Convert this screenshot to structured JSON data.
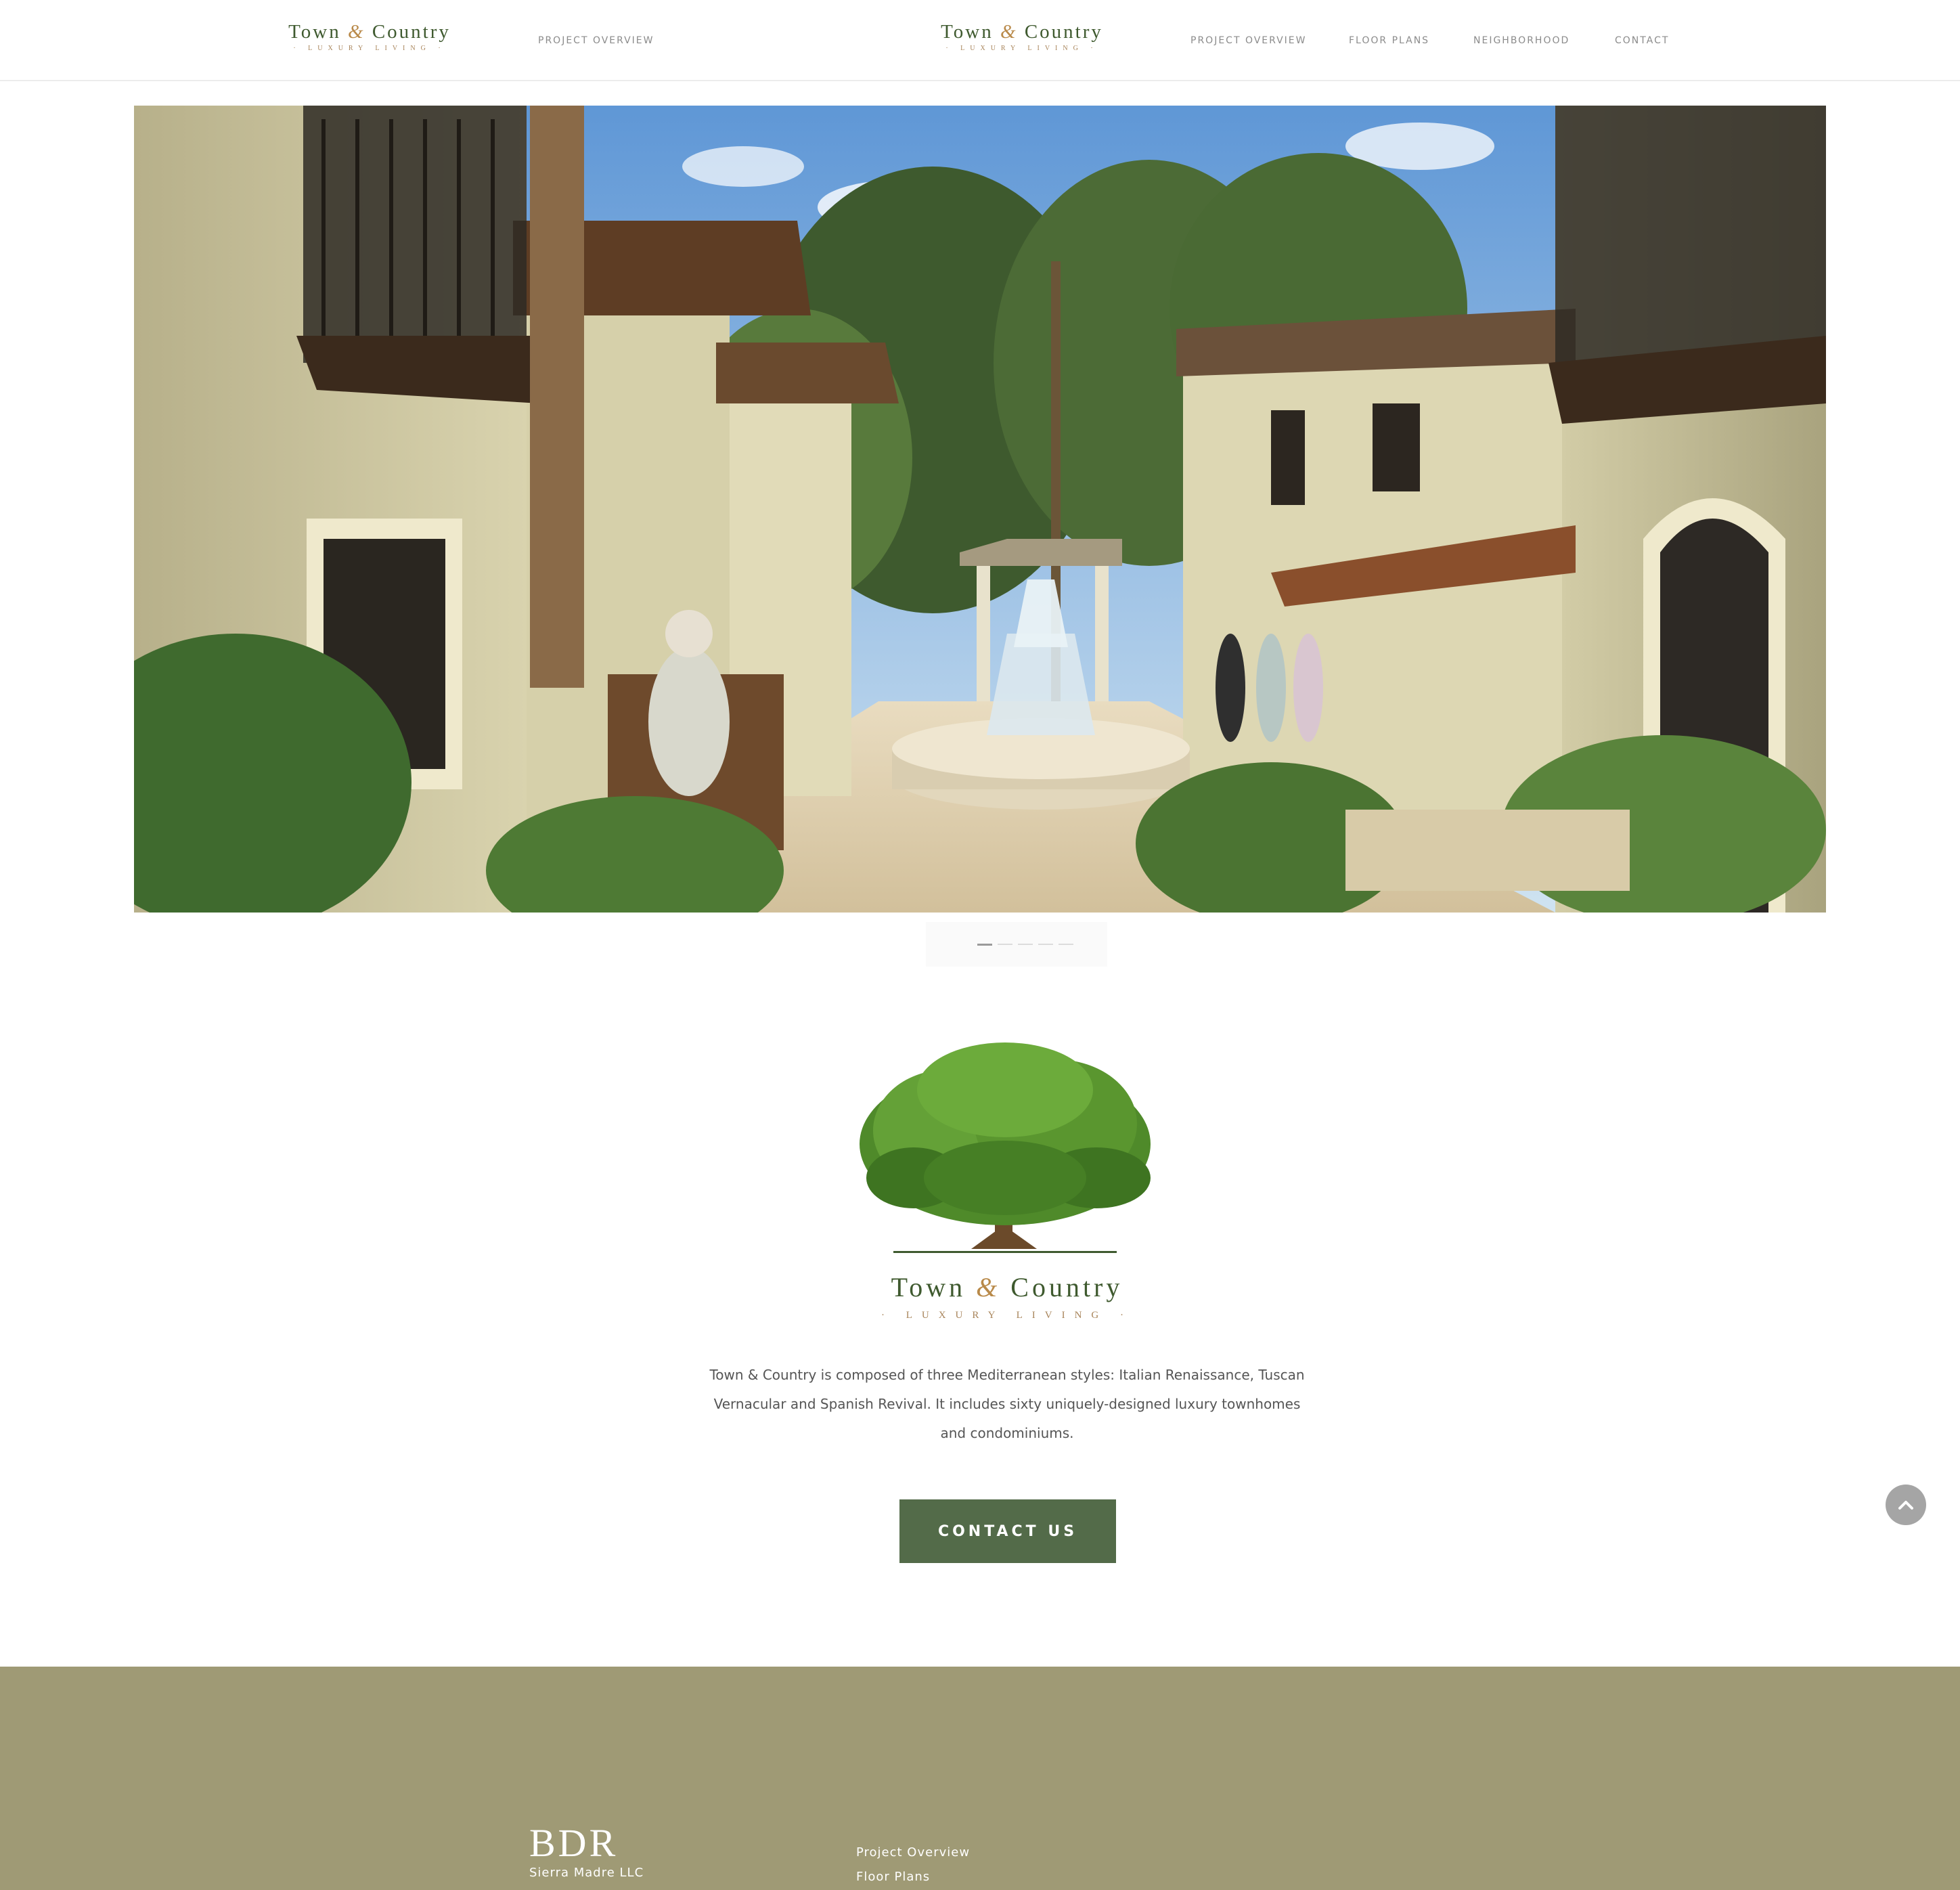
{
  "brand": {
    "name_part1": "Town",
    "ampersand": "&",
    "name_part2": "Country",
    "tagline": "LUXURY LIVING"
  },
  "header": {
    "left_nav": [
      {
        "label": "PROJECT OVERVIEW"
      }
    ],
    "nav": [
      {
        "label": "PROJECT OVERVIEW"
      },
      {
        "label": "FLOOR PLANS"
      },
      {
        "label": "NEIGHBORHOOD"
      },
      {
        "label": "CONTACT"
      }
    ]
  },
  "hero": {
    "slide_count": 5,
    "active_slide": 1
  },
  "about": {
    "description": "Town & Country is composed of three Mediterranean styles: Italian Renaissance, Tuscan Vernacular and Spanish Revival. It includes sixty uniquely-designed luxury townhomes and condominiums.",
    "cta_label": "CONTACT US"
  },
  "scroll_top": {
    "icon": "chevron-up-icon"
  },
  "footer": {
    "brand_text": "BDR",
    "company": "Sierra Madre LLC",
    "links": [
      {
        "label": "Project Overview"
      },
      {
        "label": "Floor Plans"
      }
    ]
  },
  "colors": {
    "accent_green": "#536b49",
    "footer_bg": "#9f9a75",
    "logo_green": "#3f5a2f",
    "logo_gold": "#a8845a"
  }
}
